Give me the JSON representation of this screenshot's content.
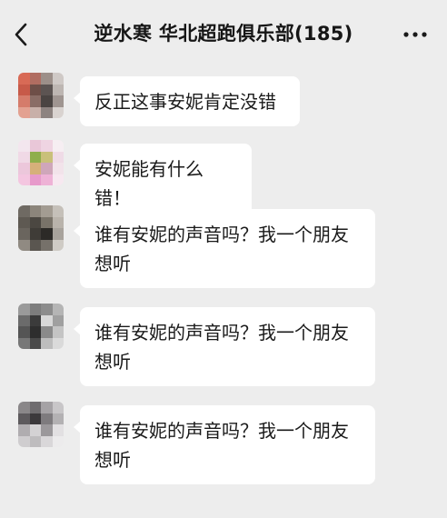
{
  "header": {
    "title": "逆水寒 华北超跑俱乐部(185)",
    "back_icon": "chevron-left-icon",
    "more_icon": "ellipsis-icon"
  },
  "messages": [
    {
      "text": "反正这事安妮肯定没错"
    },
    {
      "text": "安妮能有什么错！"
    },
    {
      "text": "谁有安妮的声音吗？我一个朋友想听"
    },
    {
      "text": "谁有安妮的声音吗？我一个朋友想听"
    },
    {
      "text": "谁有安妮的声音吗？我一个朋友想听"
    }
  ],
  "colors": {
    "background": "#ededed",
    "bubble": "#ffffff"
  }
}
